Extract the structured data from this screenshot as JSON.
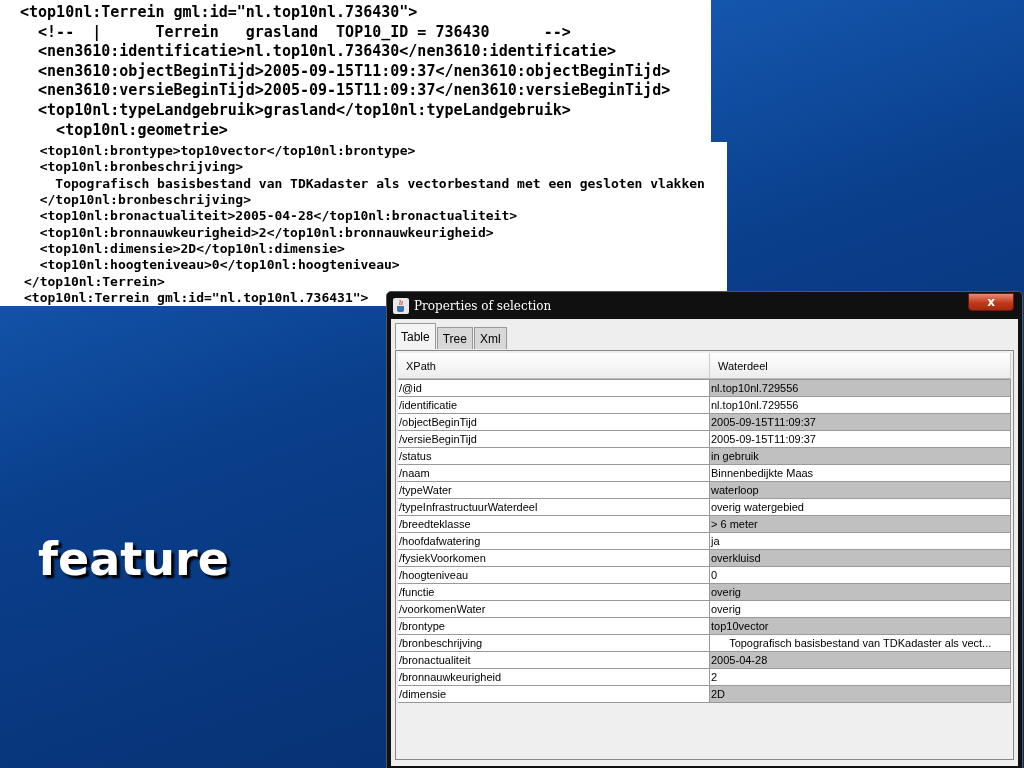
{
  "slide": {
    "title": "feature"
  },
  "xml_snippet": {
    "top_lines": [
      "<top10nl:Terrein gml:id=\"nl.top10nl.736430\">",
      "  <!--  |      Terrein   grasland  TOP10_ID = 736430      -->",
      "  <nen3610:identificatie>nl.top10nl.736430</nen3610:identificatie>",
      "  <nen3610:objectBeginTijd>2005-09-15T11:09:37</nen3610:objectBeginTijd>",
      "  <nen3610:versieBeginTijd>2005-09-15T11:09:37</nen3610:versieBeginTijd>",
      "  <top10nl:typeLandgebruik>grasland</top10nl:typeLandgebruik>",
      "    <top10nl:geometrie>"
    ],
    "bottom_lines": [
      "  <top10nl:brontype>top10vector</top10nl:brontype>",
      "  <top10nl:bronbeschrijving>",
      "    Topografisch basisbestand van TDKadaster als vectorbestand met een gesloten vlakken",
      "  </top10nl:bronbeschrijving>",
      "  <top10nl:bronactualiteit>2005-04-28</top10nl:bronactualiteit>",
      "  <top10nl:bronnauwkeurigheid>2</top10nl:bronnauwkeurigheid>",
      "  <top10nl:dimensie>2D</top10nl:dimensie>",
      "  <top10nl:hoogteniveau>0</top10nl:hoogteniveau>",
      "</top10nl:Terrein>",
      "<top10nl:Terrein gml:id=\"nl.top10nl.736431\">"
    ]
  },
  "window": {
    "title": "Properties of selection",
    "close": "x",
    "tabs": [
      {
        "label": "Table",
        "selected": true
      },
      {
        "label": "Tree",
        "selected": false
      },
      {
        "label": "Xml",
        "selected": false
      }
    ],
    "table": {
      "columns": [
        "XPath",
        "Waterdeel"
      ],
      "rows": [
        [
          "/@id",
          "nl.top10nl.729556"
        ],
        [
          "/identificatie",
          "nl.top10nl.729556"
        ],
        [
          "/objectBeginTijd",
          "2005-09-15T11:09:37"
        ],
        [
          "/versieBeginTijd",
          "2005-09-15T11:09:37"
        ],
        [
          "/status",
          "in gebruik"
        ],
        [
          "/naam",
          "Binnenbedijkte Maas"
        ],
        [
          "/typeWater",
          "waterloop"
        ],
        [
          "/typeInfrastructuurWaterdeel",
          "overig watergebied"
        ],
        [
          "/breedteklasse",
          "> 6 meter"
        ],
        [
          "/hoofdafwatering",
          "ja"
        ],
        [
          "/fysiekVoorkomen",
          "overkluisd"
        ],
        [
          "/hoogteniveau",
          "0"
        ],
        [
          "/functie",
          "overig"
        ],
        [
          "/voorkomenWater",
          "overig"
        ],
        [
          "/brontype",
          "top10vector"
        ],
        [
          "/bronbeschrijving",
          "      Topografisch basisbestand van TDKadaster als vect..."
        ],
        [
          "/bronactualiteit",
          "2005-04-28"
        ],
        [
          "/bronnauwkeurigheid",
          "2"
        ],
        [
          "/dimensie",
          "2D"
        ]
      ]
    }
  }
}
